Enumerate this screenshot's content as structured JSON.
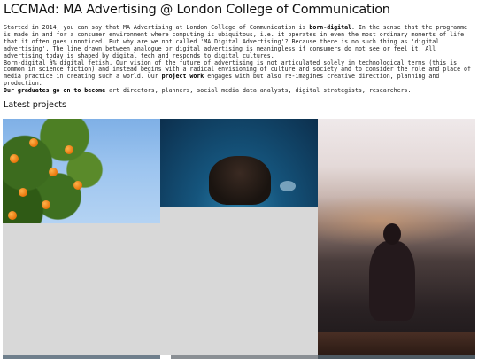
{
  "header": {
    "title": "LCCMAd: MA Advertising @ London College of Communication"
  },
  "intro": {
    "p1_a": "Started in 2014, you can say that MA Advertising at London College of Communication is ",
    "p1_b": "born-digital",
    "p1_c": ". In the sense that the programme is made in and for a consumer environment where computing is ubiquitous, i.e. it operates in even the most ordinary moments of life that it often goes unnoticed. But why are we not called 'MA Digital Advertising'? Because there is no such thing as 'digital advertising'. The line drawn between analogue or digital advertising is meaningless if consumers do not see or feel it. All advertising today is shaped by digital tech and responds to digital cultures.",
    "p2_a": "Born-digital â%  digital fetish. Our vision of the future of advertising is not articulated solely in technological terms (this is common in science fiction) and instead begins with a radical envisioning of culture and society and to consider the role and place of media practice in creating such a world. Our ",
    "p2_b": "project work",
    "p2_c": " engages with but also re-imagines creative direction, planning and production.",
    "p3_a": "Our graduates go on to become",
    "p3_b": " art directors, planners, social media data analysts, digital strategists, researchers."
  },
  "projects": {
    "title": "Latest projects"
  }
}
